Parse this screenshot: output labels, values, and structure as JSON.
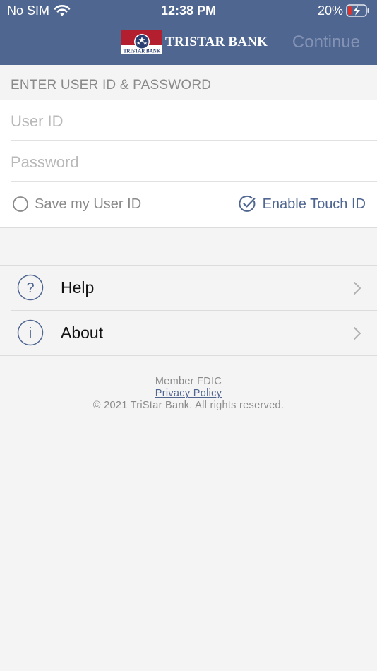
{
  "status_bar": {
    "carrier": "No SIM",
    "time": "12:38 PM",
    "battery_percent": "20%",
    "battery_level": 0.2,
    "icons": [
      "wifi-icon",
      "battery-charging-icon"
    ]
  },
  "nav": {
    "logo_text": "TRISTAR BANK",
    "logo_badge_text": "TRISTAR BANK",
    "continue_label": "Continue"
  },
  "login": {
    "section_label": "ENTER USER ID & PASSWORD",
    "user_id_placeholder": "User ID",
    "password_placeholder": "Password",
    "save_user_id_label": "Save my User ID",
    "save_user_id_checked": false,
    "enable_touch_id_label": "Enable Touch ID",
    "enable_touch_id_checked": true
  },
  "menu": {
    "help_label": "Help",
    "about_label": "About",
    "help_icon": "question-mark-icon",
    "about_icon": "info-icon"
  },
  "footer": {
    "member": "Member FDIC",
    "privacy": "Privacy Policy",
    "copyright": "© 2021 TriStar Bank. All rights reserved."
  },
  "colors": {
    "header_bg": "#4f6691",
    "accent": "#4f6691",
    "continue_disabled": "#8493b4",
    "battery_low": "#e0322b",
    "logo_red": "#b31f2e"
  }
}
